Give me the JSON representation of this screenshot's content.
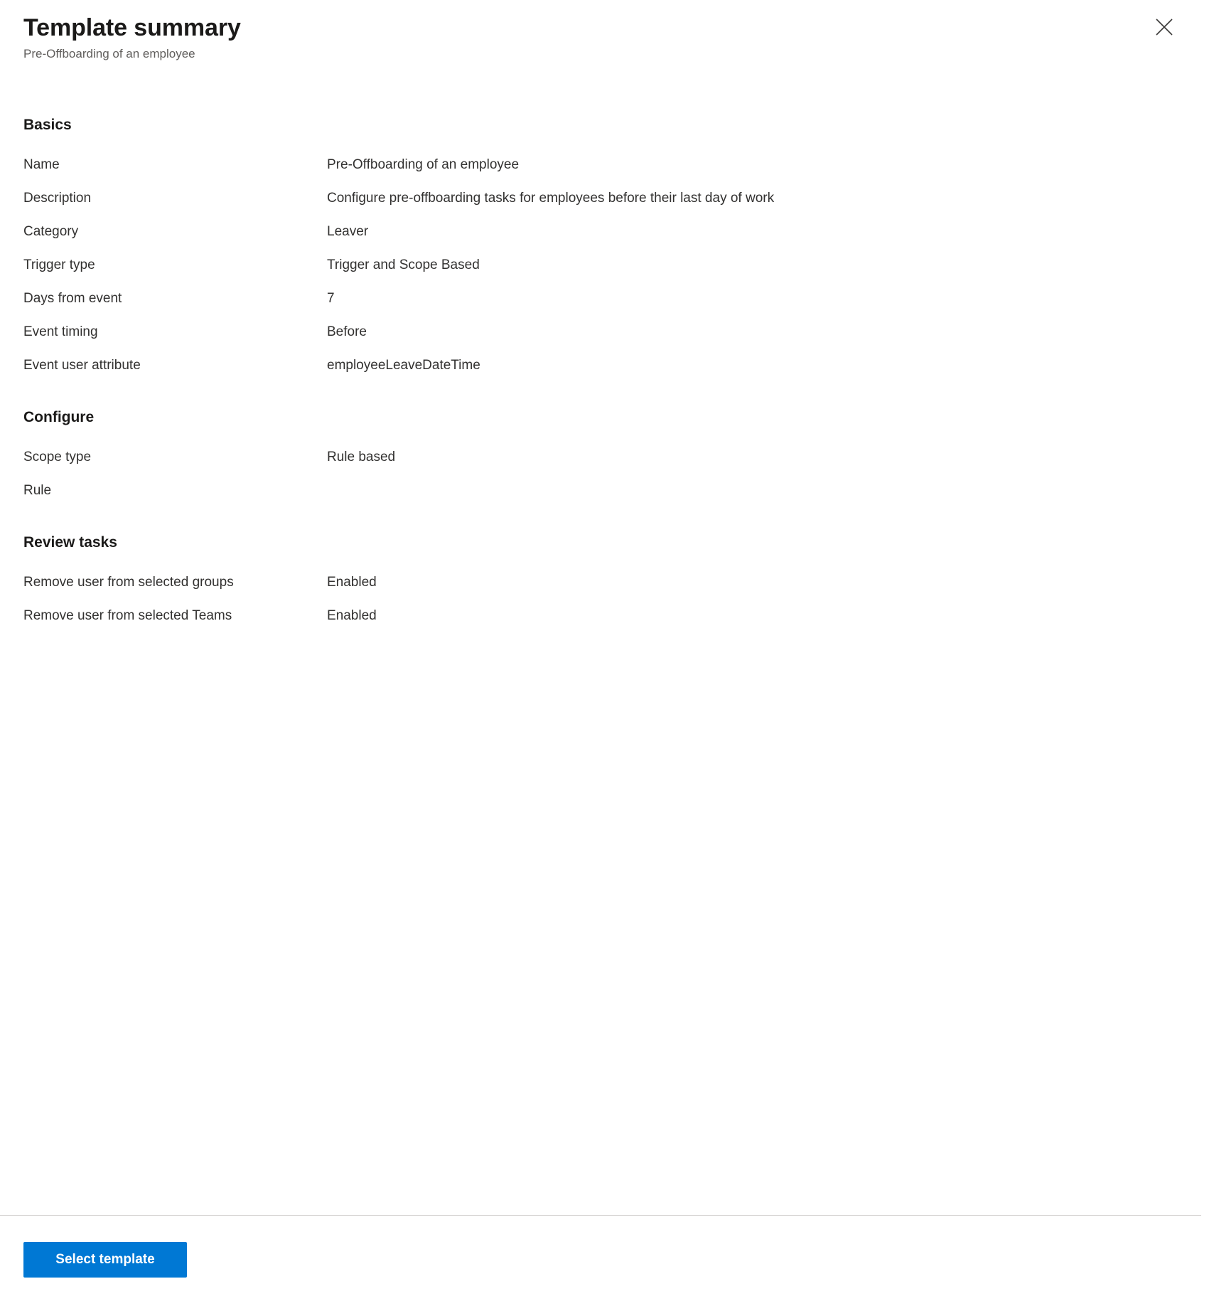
{
  "header": {
    "title": "Template summary",
    "subtitle": "Pre-Offboarding of an employee",
    "close_icon": "close-icon",
    "close_label": "Close"
  },
  "sections": [
    {
      "heading": "Basics",
      "rows": [
        {
          "label": "Name",
          "value": "Pre-Offboarding of an employee"
        },
        {
          "label": "Description",
          "value": "Configure pre-offboarding tasks for employees before their last day of work"
        },
        {
          "label": "Category",
          "value": "Leaver"
        },
        {
          "label": "Trigger type",
          "value": "Trigger and Scope Based"
        },
        {
          "label": "Days from event",
          "value": "7"
        },
        {
          "label": "Event timing",
          "value": "Before"
        },
        {
          "label": "Event user attribute",
          "value": "employeeLeaveDateTime"
        }
      ]
    },
    {
      "heading": "Configure",
      "rows": [
        {
          "label": "Scope type",
          "value": "Rule based"
        },
        {
          "label": "Rule",
          "value": ""
        }
      ]
    },
    {
      "heading": "Review tasks",
      "rows": [
        {
          "label": "Remove user from selected groups",
          "value": "Enabled"
        },
        {
          "label": "Remove user from selected Teams",
          "value": "Enabled"
        }
      ]
    }
  ],
  "footer": {
    "primary_button_label": "Select template"
  },
  "colors": {
    "accent": "#0078d4",
    "text": "#323130",
    "heading": "#1b1a19",
    "subtle_text": "#605e5c",
    "divider": "#d2d0ce",
    "background": "#ffffff"
  }
}
